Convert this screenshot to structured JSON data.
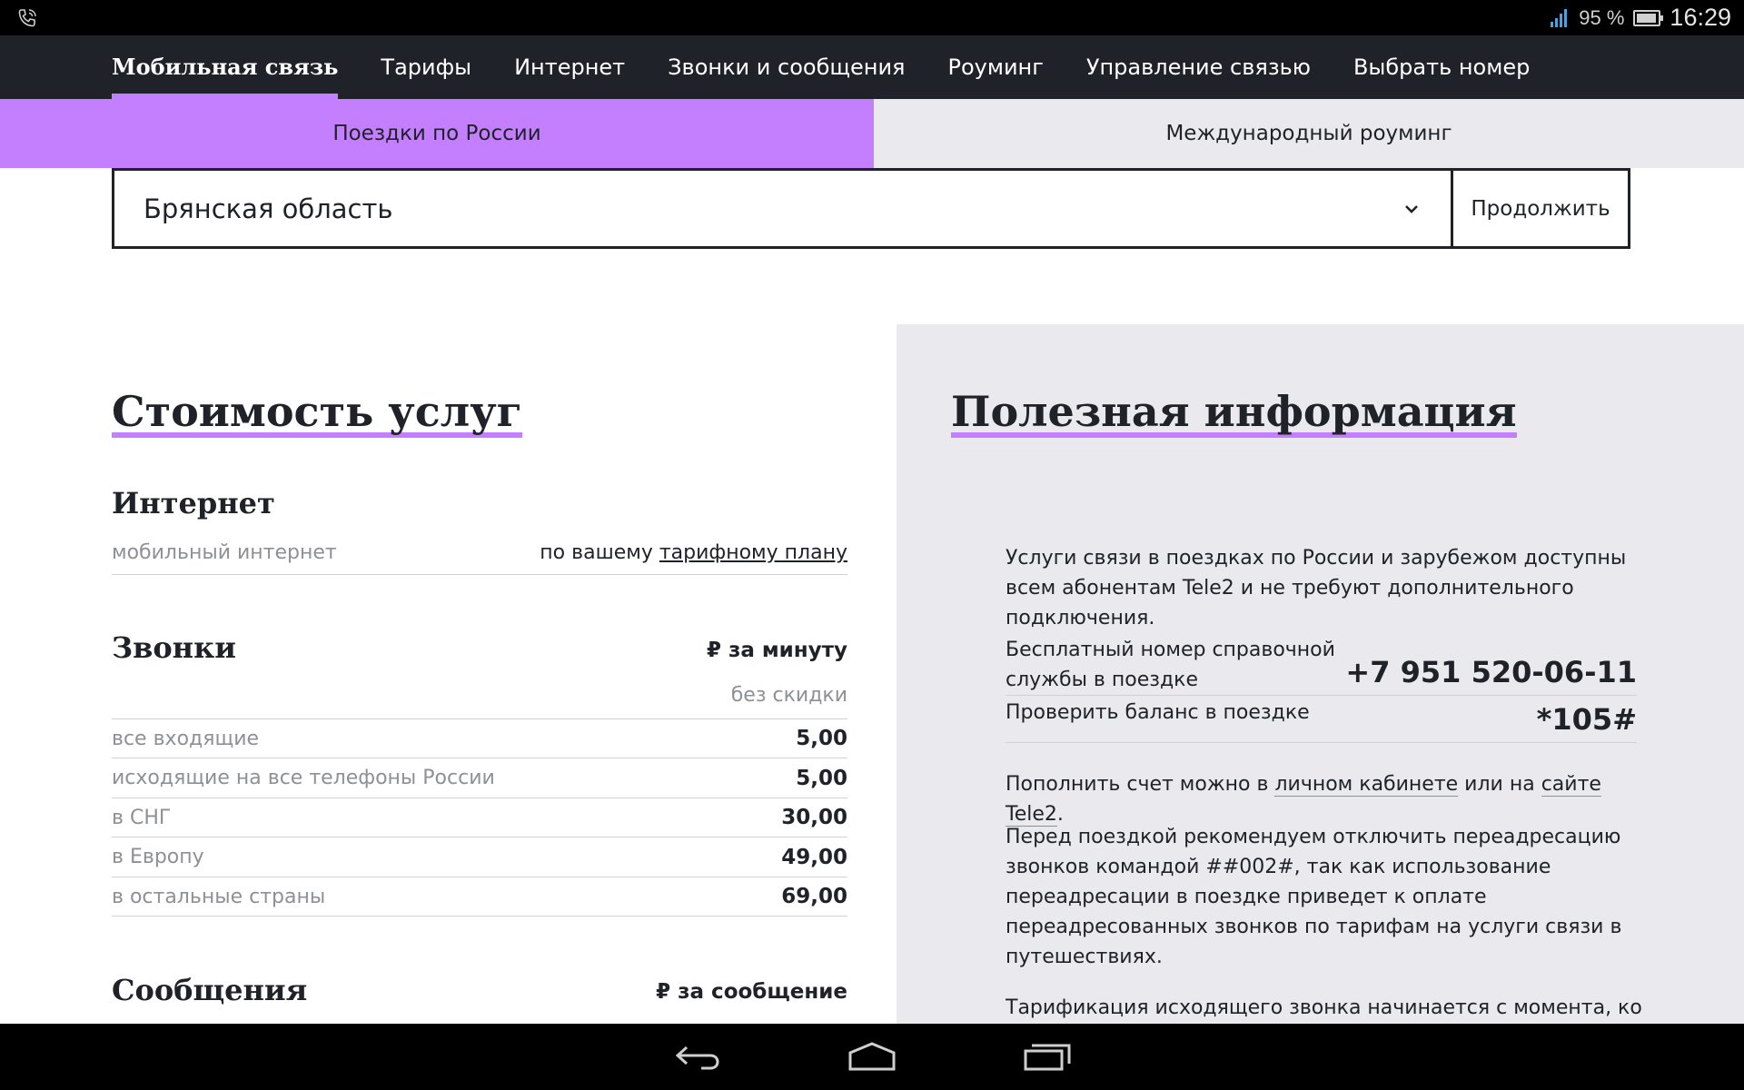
{
  "status_bar": {
    "battery_percent": "95 %",
    "time": "16:29"
  },
  "nav": {
    "items": [
      {
        "label": "Мобильная связь",
        "active": true
      },
      {
        "label": "Тарифы"
      },
      {
        "label": "Интернет"
      },
      {
        "label": "Звонки и сообщения"
      },
      {
        "label": "Роуминг"
      },
      {
        "label": "Управление связью"
      },
      {
        "label": "Выбрать номер"
      }
    ]
  },
  "tabs": {
    "domestic": "Поездки по России",
    "international": "Международный роуминг"
  },
  "region_select": {
    "value": "Брянская область",
    "continue_label": "Продолжить"
  },
  "pricing": {
    "title": "Стоимость услуг",
    "internet": {
      "title": "Интернет",
      "label": "мобильный интернет",
      "value_prefix": "по вашему ",
      "value_link": "тарифному плану"
    },
    "calls": {
      "title": "Звонки",
      "unit": "₽ за минуту",
      "subheader": "без скидки",
      "rows": [
        {
          "label": "все входящие",
          "value": "5,00"
        },
        {
          "label": "исходящие на все телефоны России",
          "value": "5,00"
        },
        {
          "label": "в СНГ",
          "value": "30,00"
        },
        {
          "label": "в Европу",
          "value": "49,00"
        },
        {
          "label": "в остальные страны",
          "value": "69,00"
        }
      ]
    },
    "messages": {
      "title": "Сообщения",
      "unit": "₽ за сообщение"
    }
  },
  "info": {
    "title": "Полезная информация",
    "intro": "Услуги связи в поездках по России и зарубежом доступны всем абонентам Tele2 и не требуют дополнительного подключения.",
    "helpline_label_1": "Бесплатный номер справочной",
    "helpline_label_2": "службы в поездке",
    "helpline_number": "+7 951 520-06-11",
    "balance_label": "Проверить баланс в поездке",
    "balance_code": "*105#",
    "topup_prefix": "Пополнить счет можно в ",
    "topup_link1": "личном кабинете",
    "topup_mid": " или на ",
    "topup_link2": "сайте Tele2",
    "topup_suffix": ".",
    "forwarding": "Перед поездкой рекомендуем отключить переадресацию звонков командой ##002#, так как использование переадресации в поездке приведет к оплате переадресованных звонков по тарифам на услуги связи в путешествиях.",
    "billing": "Тарификация исходящего звонка начинается с момента, когда"
  },
  "colors": {
    "accent": "#c47fff",
    "nav_bg": "#1f2229",
    "panel_bg": "#e9e9ee"
  }
}
